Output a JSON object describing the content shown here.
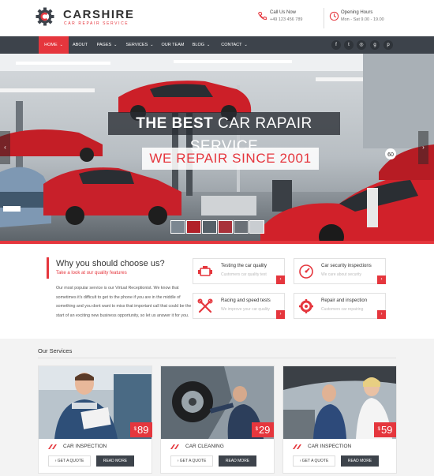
{
  "header": {
    "brand": "CARSHIRE",
    "tagline": "CAR REPAIR SERVICE",
    "call_title": "Call Us Now",
    "call_value": "+49 123 456 789",
    "hours_title": "Opening Hours",
    "hours_value": "Mon - Sat 9.00 - 19.00"
  },
  "nav": {
    "items": [
      {
        "label": "HOME",
        "caret": "⌄"
      },
      {
        "label": "ABOUT",
        "caret": ""
      },
      {
        "label": "PAGES",
        "caret": "⌄"
      },
      {
        "label": "SERVICES",
        "caret": "⌄"
      },
      {
        "label": "OUR TEAM",
        "caret": ""
      },
      {
        "label": "BLOG",
        "caret": "⌄"
      },
      {
        "label": "CONTACT",
        "caret": "⌄"
      }
    ],
    "social": [
      "f",
      "t",
      "◎",
      "g",
      "p"
    ],
    "social_icons": [
      "facebook-icon",
      "twitter-icon",
      "instagram-icon",
      "google-plus-icon",
      "pinterest-icon"
    ]
  },
  "hero": {
    "headline_bold": "THE BEST",
    "headline_rest": " CAR RAPAIR SERVICE",
    "subline": "WE REPAIR SINCE 2001",
    "sign": "60",
    "prev": "‹",
    "next": "›"
  },
  "why": {
    "title": "Why you should choose us?",
    "subtitle": "Take a look at our quality features",
    "paragraph": "Our most popular service is our Virtual Receptionist. We know that sometimes it's difficult to get to the phone if you are in the middle of something and you dont want to miss that important call that could be the start of an exciting new business opportunity, so let us answer it for you.",
    "features": [
      {
        "title": "Testing the car quality",
        "sub": "Customers car quality test",
        "arrow": "›"
      },
      {
        "title": "Car security inspections",
        "sub": "We care about security",
        "arrow": "›"
      },
      {
        "title": "Racing and speed tests",
        "sub": "We improve your car quality",
        "arrow": "›"
      },
      {
        "title": "Repair and inspection",
        "sub": "Customers car repairing",
        "arrow": "›"
      }
    ]
  },
  "services": {
    "heading": "Our Services",
    "cards": [
      {
        "title": "CAR INSPECTION",
        "currency": "$",
        "price": "89",
        "quote": "GET A QUOTE",
        "more": "READ MORE"
      },
      {
        "title": "CAR CLEANING",
        "currency": "$",
        "price": "29",
        "quote": "GET A QUOTE",
        "more": "READ MORE"
      },
      {
        "title": "CAR INSPECTION",
        "currency": "$",
        "price": "59",
        "quote": "GET A QUOTE",
        "more": "READ MORE"
      }
    ]
  },
  "colors": {
    "accent": "#e5363d",
    "dark": "#3d434b"
  }
}
